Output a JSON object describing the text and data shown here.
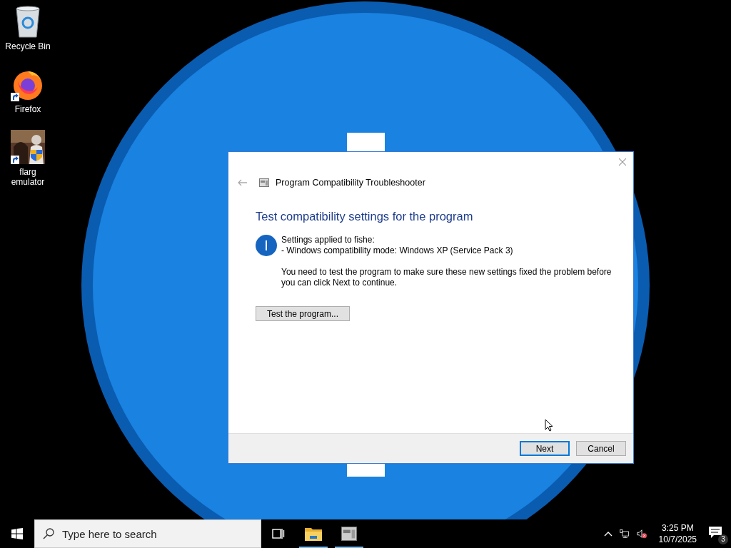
{
  "desktop_icons": [
    {
      "label": "Recycle Bin",
      "kind": "recycle",
      "shortcut": false
    },
    {
      "label": "Firefox",
      "kind": "firefox",
      "shortcut": true
    },
    {
      "label": "flarg emulator",
      "kind": "picture",
      "shortcut": true
    }
  ],
  "dialog": {
    "title": "Program Compatibility Troubleshooter",
    "heading": "Test compatibility settings for the program",
    "info_lines": [
      "Settings applied to fishe:",
      "- Windows compatibility mode: Windows XP (Service Pack 3)"
    ],
    "message": "You need to test the program to make sure these new settings fixed the problem before you can click Next to continue.",
    "test_button": "Test the program...",
    "buttons": [
      {
        "label": "Next",
        "default": true
      },
      {
        "label": "Cancel",
        "default": false
      }
    ]
  },
  "taskbar": {
    "search": {
      "placeholder": "Type here to search"
    },
    "apps": [
      {
        "kind": "task-view",
        "running": false
      },
      {
        "kind": "explorer",
        "running": true
      },
      {
        "kind": "troubleshooter",
        "running": true
      }
    ],
    "tray": {
      "volume_muted": true,
      "time": "3:25 PM",
      "date": "10/7/2025",
      "notifications": "3"
    }
  }
}
